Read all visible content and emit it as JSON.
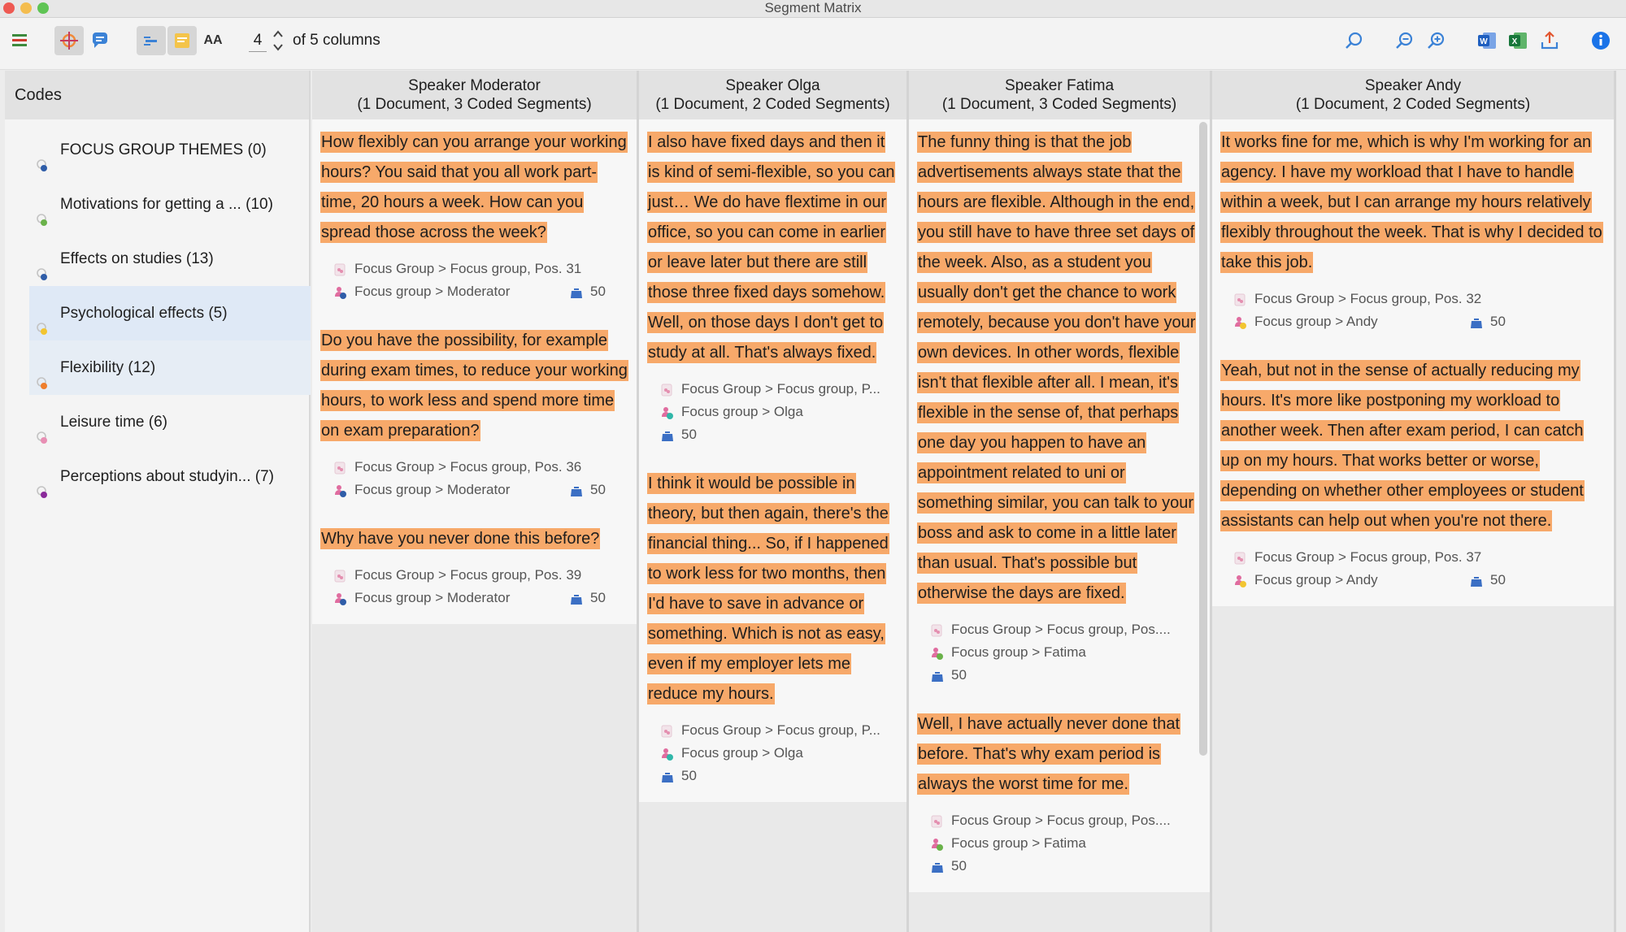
{
  "window": {
    "title": "Segment Matrix"
  },
  "toolbar": {
    "column_count_value": "4",
    "column_count_suffix": "of 5 columns",
    "text_size_label": "AA"
  },
  "colors": {
    "highlight": "#f7a96a",
    "selected_row": "#dfe9f6",
    "accent_blue": "#2d72d9"
  },
  "sidebar": {
    "header": "Codes",
    "items": [
      {
        "label": "FOCUS GROUP THEMES (0)",
        "color": "#2f5da8"
      },
      {
        "label": "Motivations for getting a ... (10)",
        "color": "#6ab24a"
      },
      {
        "label": "Effects on studies (13)",
        "color": "#2f5da8"
      },
      {
        "label": "Psychological effects (5)",
        "color": "#f2c531"
      },
      {
        "label": "Flexibility (12)",
        "color": "#ef7e2c"
      },
      {
        "label": "Leisure time (6)",
        "color": "#e88fb4"
      },
      {
        "label": "Perceptions about studyin... (7)",
        "color": "#8a2a9a"
      }
    ]
  },
  "columns": [
    {
      "speaker": "Speaker Moderator",
      "summary": "(1 Document, 3 Coded Segments)",
      "segments": [
        {
          "text": "How flexibly can you arrange your working hours? You said that you all work part-time, 20 hours a week. How can you spread those across the week?",
          "doc": "Focus Group > Focus group, Pos. 31",
          "speaker_ref": "Focus group > Moderator",
          "weight": "50"
        },
        {
          "text": "Do you have the possibility, for example during exam times, to reduce your working hours, to work less and spend more time on exam preparation?",
          "doc": "Focus Group > Focus group, Pos. 36",
          "speaker_ref": "Focus group > Moderator",
          "weight": "50"
        },
        {
          "text": "Why have you never done this before?",
          "doc": "Focus Group > Focus group, Pos. 39",
          "speaker_ref": "Focus group > Moderator",
          "weight": "50"
        }
      ]
    },
    {
      "speaker": "Speaker Olga",
      "summary": "(1 Document, 2 Coded Segments)",
      "segments": [
        {
          "text": "I also have fixed days and then it is kind of semi-flexible, so you can just… We do have flextime in our office, so you can come in earlier or leave later but there are still those three fixed days somehow. Well, on those days I don't get to study at all. That's always fixed.",
          "doc": "Focus Group > Focus group, P...",
          "speaker_ref": "Focus group > Olga",
          "weight": "50"
        },
        {
          "text": "I think it would be possible in theory, but then again, there's the financial thing... So, if I happened to work less for two months, then I'd have to save in advance or something. Which is not as easy, even if my employer lets me reduce my hours.",
          "doc": "Focus Group > Focus group, P...",
          "speaker_ref": "Focus group > Olga",
          "weight": "50"
        }
      ]
    },
    {
      "speaker": "Speaker Fatima",
      "summary": "(1 Document, 3 Coded Segments)",
      "segments": [
        {
          "text": "The funny thing is that the job advertisements always state that the hours are flexible. Although in the end, you still have to have three set days of the week. Also, as a student you usually don't get the chance to work remotely, because you don't have your own devices. In other words, flexible isn't that flexible after all. I mean, it's flexible in the sense of, that perhaps one day you happen to have an appointment related to uni or something similar, you can talk to your boss and ask to come in a little later than usual. That's possible but otherwise the days are fixed.",
          "doc": "Focus Group > Focus group, Pos....",
          "speaker_ref": "Focus group > Fatima",
          "weight": "50"
        },
        {
          "text": "Well, I have actually never done that before. That's why exam period is always the worst time for me.",
          "doc": "Focus Group > Focus group, Pos....",
          "speaker_ref": "Focus group > Fatima",
          "weight": "50"
        }
      ]
    },
    {
      "speaker": "Speaker Andy",
      "summary": "(1 Document, 2 Coded Segments)",
      "segments": [
        {
          "text": "It works fine for me, which is why I'm working for an agency. I have my workload that I have to handle within a week, but I can arrange my hours relatively flexibly throughout the week. That is why I decided to take this job.",
          "doc": "Focus Group > Focus group, Pos. 32",
          "speaker_ref": "Focus group > Andy",
          "weight": "50"
        },
        {
          "text": "Yeah, but not in the sense of actually reducing my hours. It's more like postponing my workload to another week. Then after exam period, I can catch up on my hours. That works better or worse, depending on whether other employees or student assistants can help out when you're not there.",
          "doc": "Focus Group > Focus group, Pos. 37",
          "speaker_ref": "Focus group > Andy",
          "weight": "50"
        }
      ]
    }
  ]
}
